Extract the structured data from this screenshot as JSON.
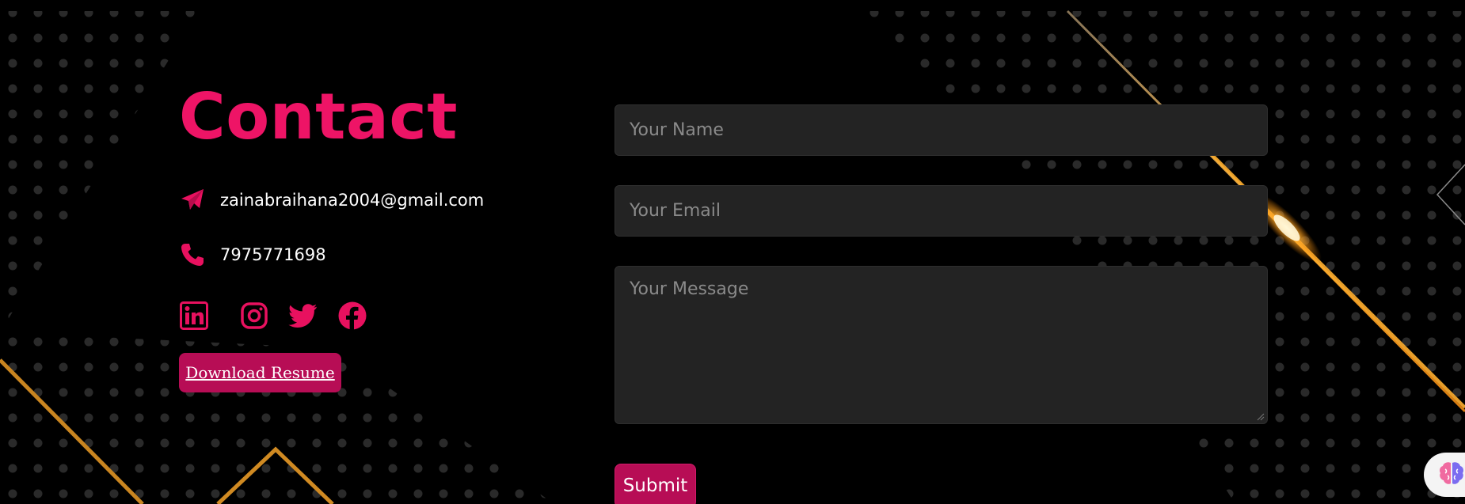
{
  "contact": {
    "title": "Contact",
    "email": "zainabraihana2004@gmail.com",
    "phone": "7975771698",
    "socials": [
      {
        "name": "linkedin-icon"
      },
      {
        "name": "instagram-icon"
      },
      {
        "name": "twitter-icon"
      },
      {
        "name": "facebook-icon"
      }
    ],
    "download_label": "Download Resume"
  },
  "form": {
    "name_placeholder": "Your Name",
    "email_placeholder": "Your Email",
    "message_placeholder": "Your Message",
    "submit_label": "Submit"
  },
  "colors": {
    "accent": "#ee1466",
    "button": "#b70d55",
    "field_bg": "#232323",
    "background": "#000000",
    "glow": "#ff9a1f"
  }
}
